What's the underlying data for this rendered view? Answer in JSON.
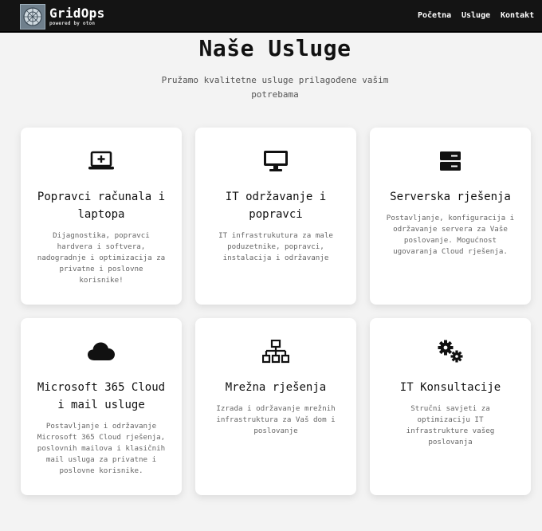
{
  "brand": {
    "name": "GridOps",
    "tagline": "powered by oton"
  },
  "nav": {
    "items": [
      {
        "label": "Početna"
      },
      {
        "label": "Usluge"
      },
      {
        "label": "Kontakt"
      }
    ]
  },
  "main": {
    "title": "Naše Usluge",
    "subtitle": "Pružamo kvalitetne usluge prilagođene vašim potrebama"
  },
  "services": [
    {
      "icon": "laptop-icon",
      "title": "Popravci računala i laptopa",
      "description": "Dijagnostika, popravci hardvera i softvera, nadogradnje i optimizacija za privatne i poslovne korisnike!"
    },
    {
      "icon": "desktop-icon",
      "title": "IT održavanje i popravci",
      "description": "IT infrastrukutura za male poduzetnike, popravci, instalacija i održavanje"
    },
    {
      "icon": "server-icon",
      "title": "Serverska rješenja",
      "description": "Postavljanje, konfiguracija i održavanje servera za Vaše poslovanje. Mogućnost ugovaranja Cloud rješenja."
    },
    {
      "icon": "cloud-icon",
      "title": "Microsoft 365 Cloud i mail usluge",
      "description": "Postavljanje i održavanje Microsoft 365 Cloud rješenja, poslovnih mailova i klasičnih mail usluga za privatne i poslovne korisnike."
    },
    {
      "icon": "network-icon",
      "title": "Mrežna rješenja",
      "description": "Izrada i održavanje mrežnih infrastruktura za Vaš dom i poslovanje"
    },
    {
      "icon": "gears-icon",
      "title": "IT Konsultacije",
      "description": "Stručni savjeti za optimizaciju IT infrastrukture vašeg poslovanja"
    }
  ],
  "colors": {
    "navbar": "#141414",
    "background": "#f3f3f3",
    "card": "#ffffff",
    "text": "#111111",
    "muted": "#666666"
  }
}
